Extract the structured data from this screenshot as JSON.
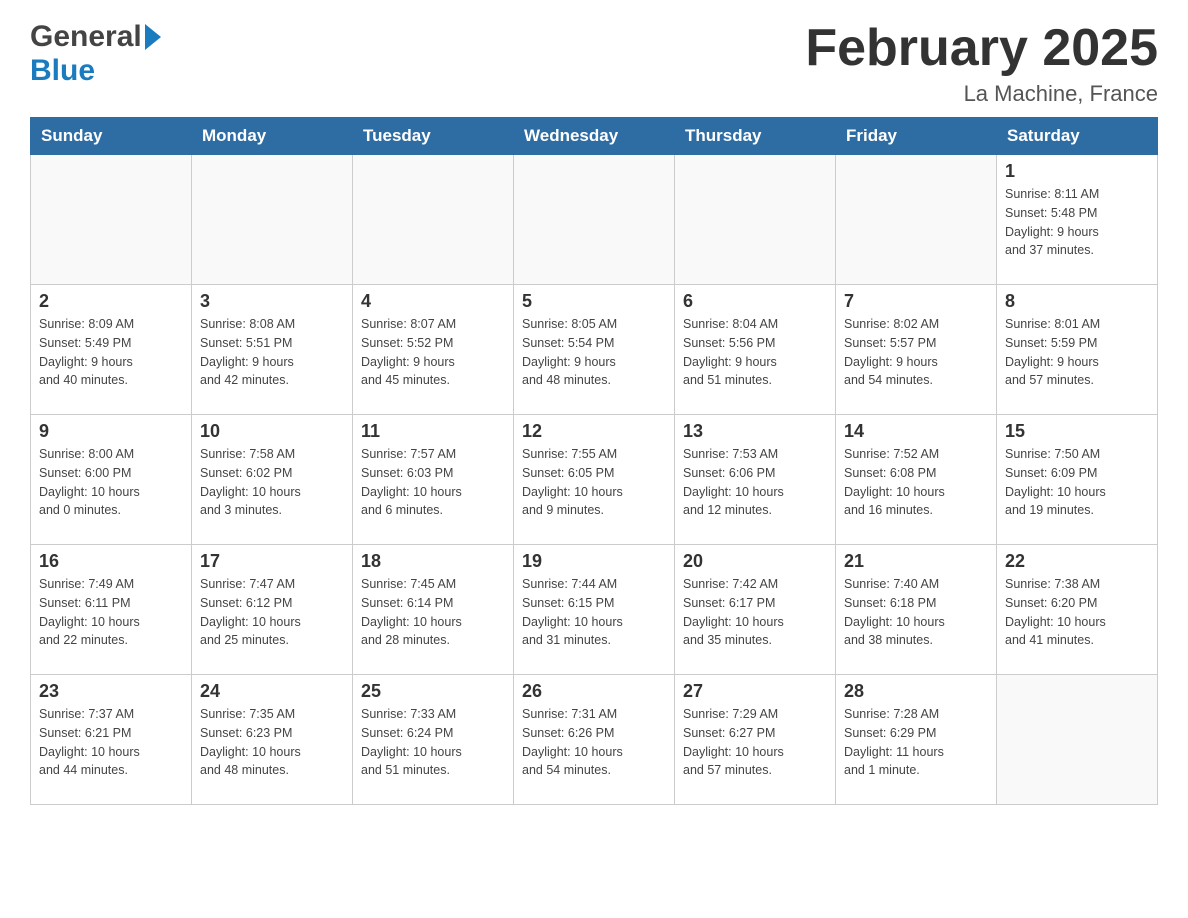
{
  "header": {
    "logo_general": "General",
    "logo_blue": "Blue",
    "month_title": "February 2025",
    "location": "La Machine, France"
  },
  "weekdays": [
    "Sunday",
    "Monday",
    "Tuesday",
    "Wednesday",
    "Thursday",
    "Friday",
    "Saturday"
  ],
  "weeks": [
    [
      {
        "day": "",
        "info": ""
      },
      {
        "day": "",
        "info": ""
      },
      {
        "day": "",
        "info": ""
      },
      {
        "day": "",
        "info": ""
      },
      {
        "day": "",
        "info": ""
      },
      {
        "day": "",
        "info": ""
      },
      {
        "day": "1",
        "info": "Sunrise: 8:11 AM\nSunset: 5:48 PM\nDaylight: 9 hours\nand 37 minutes."
      }
    ],
    [
      {
        "day": "2",
        "info": "Sunrise: 8:09 AM\nSunset: 5:49 PM\nDaylight: 9 hours\nand 40 minutes."
      },
      {
        "day": "3",
        "info": "Sunrise: 8:08 AM\nSunset: 5:51 PM\nDaylight: 9 hours\nand 42 minutes."
      },
      {
        "day": "4",
        "info": "Sunrise: 8:07 AM\nSunset: 5:52 PM\nDaylight: 9 hours\nand 45 minutes."
      },
      {
        "day": "5",
        "info": "Sunrise: 8:05 AM\nSunset: 5:54 PM\nDaylight: 9 hours\nand 48 minutes."
      },
      {
        "day": "6",
        "info": "Sunrise: 8:04 AM\nSunset: 5:56 PM\nDaylight: 9 hours\nand 51 minutes."
      },
      {
        "day": "7",
        "info": "Sunrise: 8:02 AM\nSunset: 5:57 PM\nDaylight: 9 hours\nand 54 minutes."
      },
      {
        "day": "8",
        "info": "Sunrise: 8:01 AM\nSunset: 5:59 PM\nDaylight: 9 hours\nand 57 minutes."
      }
    ],
    [
      {
        "day": "9",
        "info": "Sunrise: 8:00 AM\nSunset: 6:00 PM\nDaylight: 10 hours\nand 0 minutes."
      },
      {
        "day": "10",
        "info": "Sunrise: 7:58 AM\nSunset: 6:02 PM\nDaylight: 10 hours\nand 3 minutes."
      },
      {
        "day": "11",
        "info": "Sunrise: 7:57 AM\nSunset: 6:03 PM\nDaylight: 10 hours\nand 6 minutes."
      },
      {
        "day": "12",
        "info": "Sunrise: 7:55 AM\nSunset: 6:05 PM\nDaylight: 10 hours\nand 9 minutes."
      },
      {
        "day": "13",
        "info": "Sunrise: 7:53 AM\nSunset: 6:06 PM\nDaylight: 10 hours\nand 12 minutes."
      },
      {
        "day": "14",
        "info": "Sunrise: 7:52 AM\nSunset: 6:08 PM\nDaylight: 10 hours\nand 16 minutes."
      },
      {
        "day": "15",
        "info": "Sunrise: 7:50 AM\nSunset: 6:09 PM\nDaylight: 10 hours\nand 19 minutes."
      }
    ],
    [
      {
        "day": "16",
        "info": "Sunrise: 7:49 AM\nSunset: 6:11 PM\nDaylight: 10 hours\nand 22 minutes."
      },
      {
        "day": "17",
        "info": "Sunrise: 7:47 AM\nSunset: 6:12 PM\nDaylight: 10 hours\nand 25 minutes."
      },
      {
        "day": "18",
        "info": "Sunrise: 7:45 AM\nSunset: 6:14 PM\nDaylight: 10 hours\nand 28 minutes."
      },
      {
        "day": "19",
        "info": "Sunrise: 7:44 AM\nSunset: 6:15 PM\nDaylight: 10 hours\nand 31 minutes."
      },
      {
        "day": "20",
        "info": "Sunrise: 7:42 AM\nSunset: 6:17 PM\nDaylight: 10 hours\nand 35 minutes."
      },
      {
        "day": "21",
        "info": "Sunrise: 7:40 AM\nSunset: 6:18 PM\nDaylight: 10 hours\nand 38 minutes."
      },
      {
        "day": "22",
        "info": "Sunrise: 7:38 AM\nSunset: 6:20 PM\nDaylight: 10 hours\nand 41 minutes."
      }
    ],
    [
      {
        "day": "23",
        "info": "Sunrise: 7:37 AM\nSunset: 6:21 PM\nDaylight: 10 hours\nand 44 minutes."
      },
      {
        "day": "24",
        "info": "Sunrise: 7:35 AM\nSunset: 6:23 PM\nDaylight: 10 hours\nand 48 minutes."
      },
      {
        "day": "25",
        "info": "Sunrise: 7:33 AM\nSunset: 6:24 PM\nDaylight: 10 hours\nand 51 minutes."
      },
      {
        "day": "26",
        "info": "Sunrise: 7:31 AM\nSunset: 6:26 PM\nDaylight: 10 hours\nand 54 minutes."
      },
      {
        "day": "27",
        "info": "Sunrise: 7:29 AM\nSunset: 6:27 PM\nDaylight: 10 hours\nand 57 minutes."
      },
      {
        "day": "28",
        "info": "Sunrise: 7:28 AM\nSunset: 6:29 PM\nDaylight: 11 hours\nand 1 minute."
      },
      {
        "day": "",
        "info": ""
      }
    ]
  ]
}
